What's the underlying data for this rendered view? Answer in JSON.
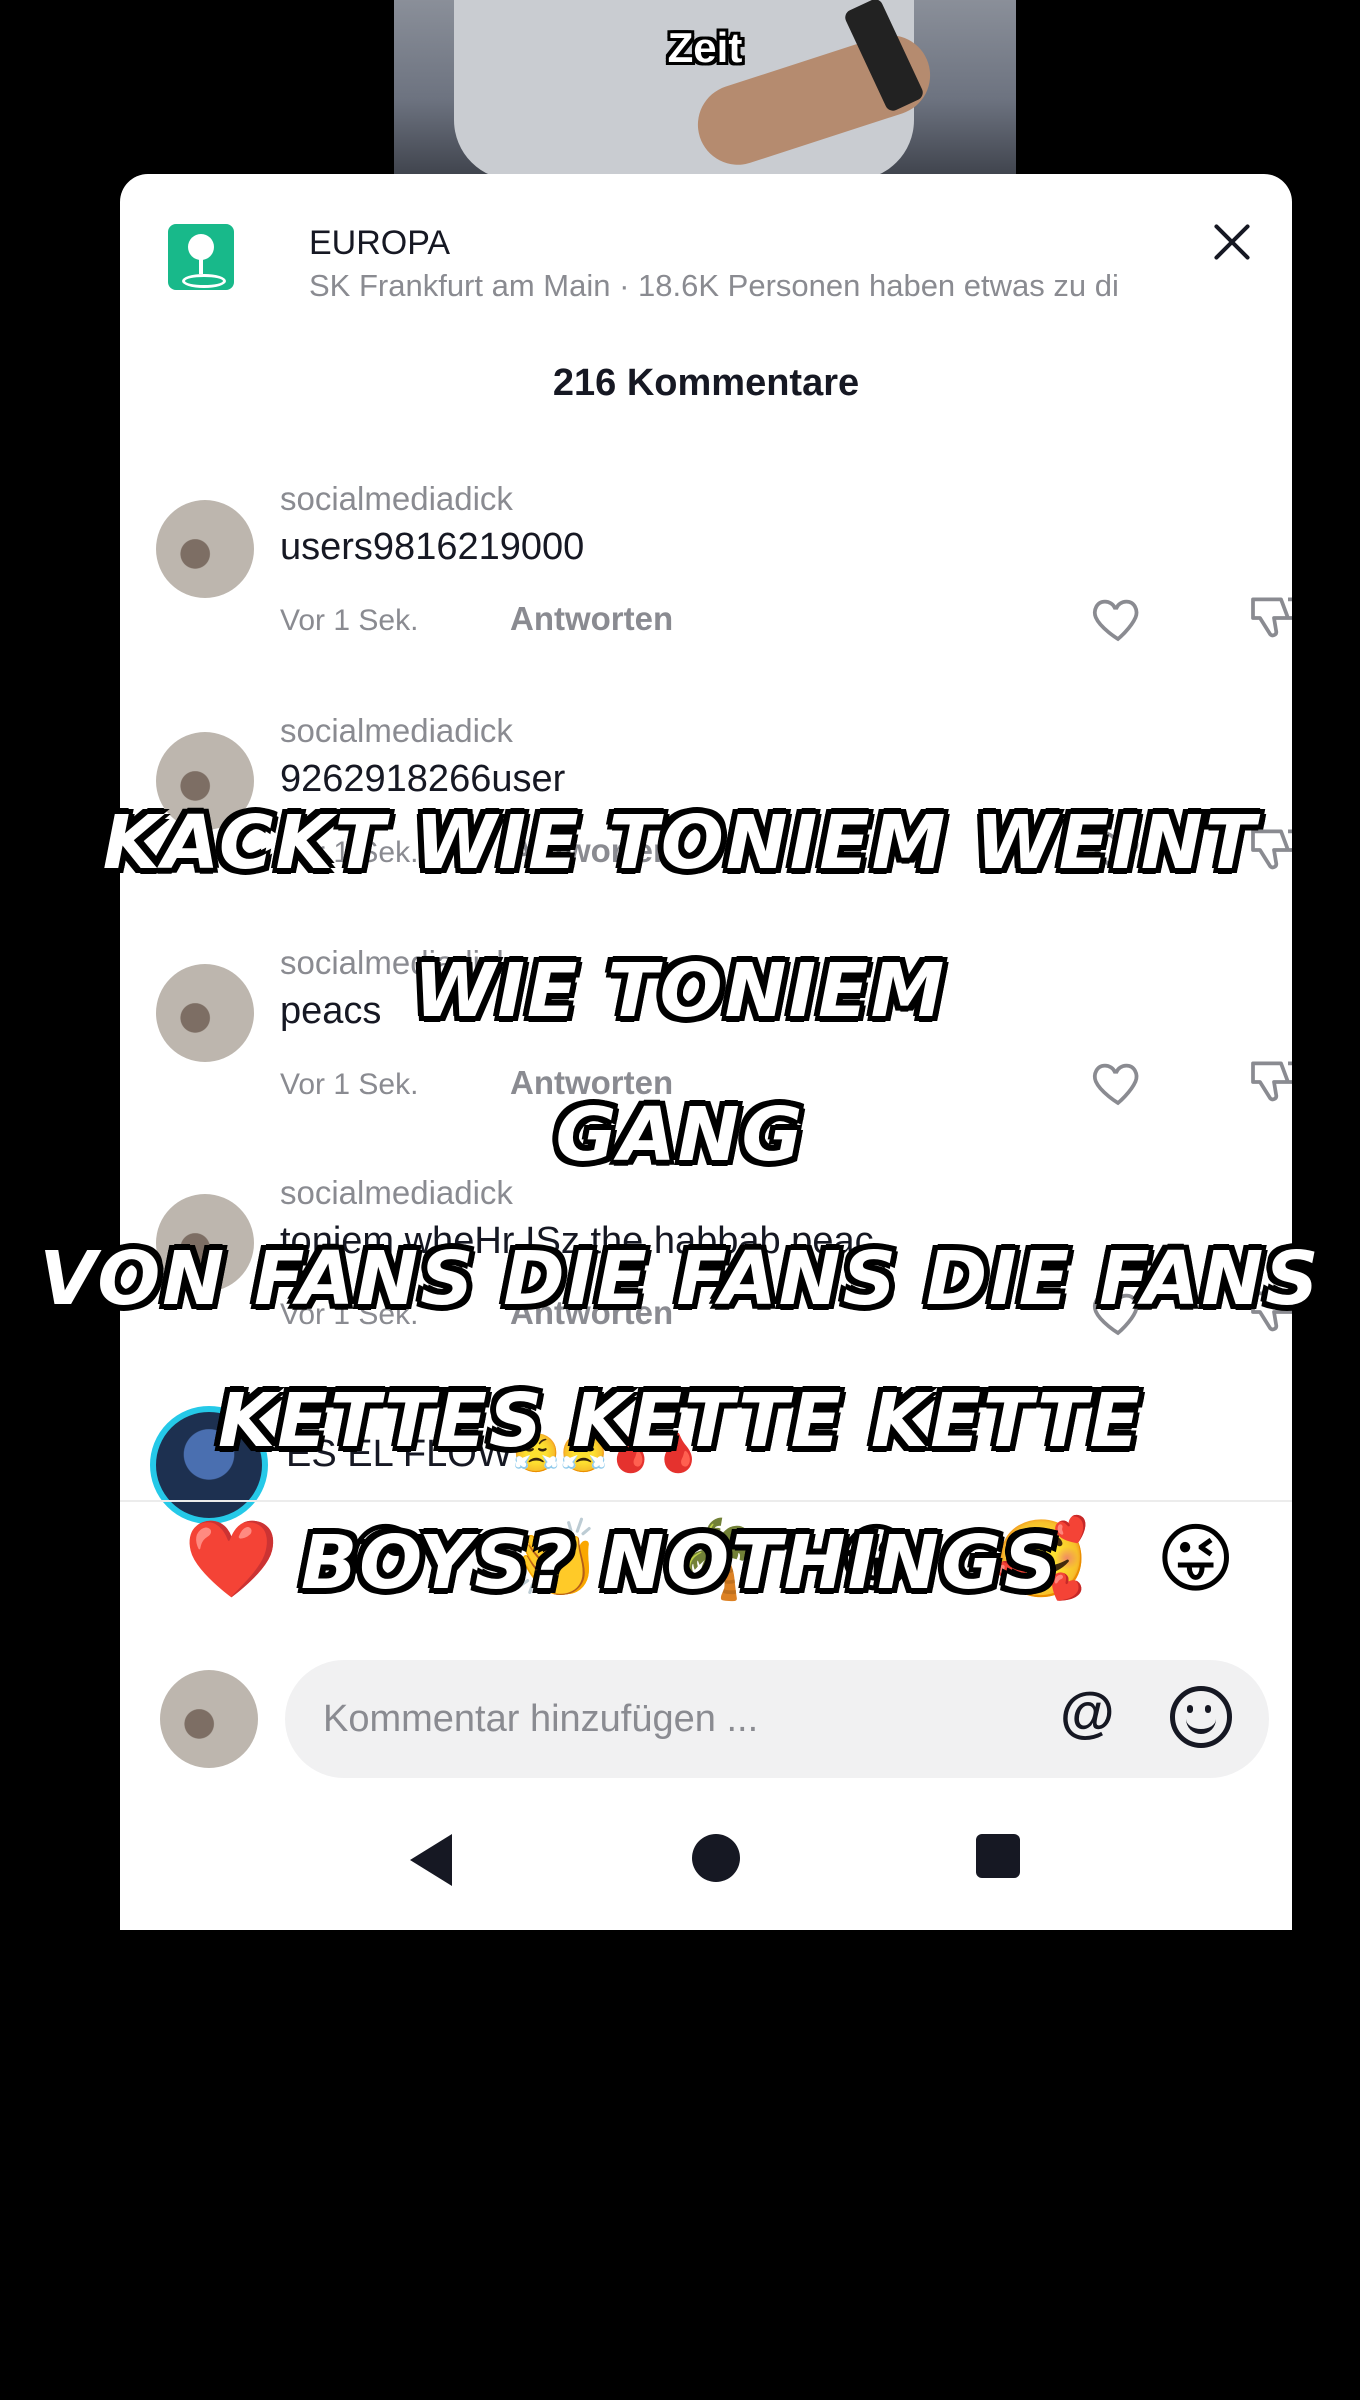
{
  "video": {
    "caption": "Zeit"
  },
  "sheet": {
    "banner": {
      "title": "EUROPA",
      "subtitle": "SK Frankfurt am Main · 18.6K Personen haben etwas zu di"
    },
    "comment_count": "216 Kommentare",
    "comments": [
      {
        "username": "socialmediadick",
        "text": "users9816219000",
        "time": "Vor 1 Sek.",
        "reply": "Antworten"
      },
      {
        "username": "socialmediadick",
        "text": "9262918266user",
        "time": "Vor 1 Sek.",
        "reply": "Antworten"
      },
      {
        "username": "socialmediadick",
        "text": "peacs",
        "time": "Vor 1 Sek.",
        "reply": "Antworten"
      },
      {
        "username": "socialmediadick",
        "text": "toniem wheHr ISz the habbab peac",
        "time": "Vor 1 Sek.",
        "reply": "Antworten"
      },
      {
        "username": "",
        "text": "ES EL FLOW😤😤🩸🩸"
      }
    ],
    "emoji_bar": [
      "❤️",
      "😎",
      "👏",
      "🌴",
      "😂",
      "🥰",
      "😜"
    ],
    "input": {
      "placeholder": "Kommentar hinzufügen ..."
    }
  },
  "overlay_captions": [
    "KACKT WIE TONIEM WEINT",
    "WIE TONIEM",
    "GANG",
    "VON FANS DIE FANS DIE FANS",
    "KETTES KETTE KETTE",
    "BOYS? NOTHINGS"
  ],
  "colors": {
    "accent_location": "#18b98a",
    "live_ring": "#25c9e8",
    "text_primary": "#161823",
    "text_secondary": "#8a8b91"
  }
}
